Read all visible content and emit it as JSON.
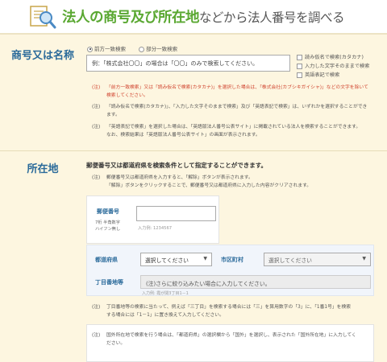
{
  "header": {
    "title_main": "法人の商号及び所在地",
    "title_tail": "などから法人番号を調べる",
    "logo_icon": "magnifier-document-icon"
  },
  "name_section": {
    "label": "商号又は名称",
    "radio_prefix": "前方一致検索",
    "radio_partial": "部分一致検索",
    "input_value": "例：「株式会社〇〇」の場合は「〇〇」のみで検索してください。",
    "check_kana": "読み仮名で検索(カタカナ)",
    "check_exact": "入力した文字そのままで検索",
    "check_english": "英語表記で検索",
    "notes": [
      {
        "tag": "(注)",
        "text": "「前方一致検索」又は「読み仮名で検索(カタカナ)」を選択した場合は、「株式会社(カブシキガイシャ)」などの文字を除いて",
        "text2": "検索してください。",
        "red": true
      },
      {
        "tag": "(注)",
        "text": "「読み仮名で検索(カタカナ)」、「入力した文字そのままで検索」及び「英語表記で検索」は、いずれかを選択することができ",
        "text2": "ます。",
        "red": false
      },
      {
        "tag": "(注)",
        "text": "「英語表記で検索」を選択した場合は、「英語版法人番号公表サイト」に掲載されている法人を検索することができます。",
        "text2": "なお、検索結果は「英語版法人番号公表サイト」の画面が表示されます。",
        "red": false
      }
    ]
  },
  "address_section": {
    "label": "所在地",
    "lead": "郵便番号又は都道府県を検索条件として指定することができます。",
    "notes": [
      {
        "tag": "(注)",
        "text": "郵便番号又は都道府県を入力すると、「解除」ボタンが表示されます。"
      },
      {
        "tag": "",
        "text": "「解除」ボタンをクリックすることで、郵便番号又は都道府県に入力した内容がクリアされます。"
      }
    ],
    "zip_label": "郵便番号",
    "zip_sub1": "7桁 半角数字",
    "zip_sub2": "ハイフン無し",
    "zip_example": "入力例: 1234567",
    "pref_label": "都道府県",
    "pref_value": "選択してください",
    "city_label": "市区町村",
    "city_value": "選択してください",
    "chome_label": "丁目番地等",
    "chome_value": "(注)さらに絞り込みたい場合に入力してください。",
    "chome_example": "入力例: 霞が関3丁目1－1",
    "notes2": [
      {
        "tag": "(注)",
        "text": "丁目番地等の検索に当たって、例えば「三丁目」を検索する場合には「三」を算用数字の「3」に、「1番1号」を検索",
        "text2": "する場合には「1－1」に置き換えて入力してください。"
      },
      {
        "tag": "(注)",
        "text": "国外所在地で検索を行う場合は、「都道府県」の選択欄から「国外」を選択し、表示された「国外所在地」に入力してく",
        "text2": "ださい。"
      }
    ]
  },
  "colors": {
    "accent_green": "#5aa832",
    "label_blue": "#2a6a9a",
    "note_red": "#d0432e",
    "background": "#fdf6e0"
  }
}
